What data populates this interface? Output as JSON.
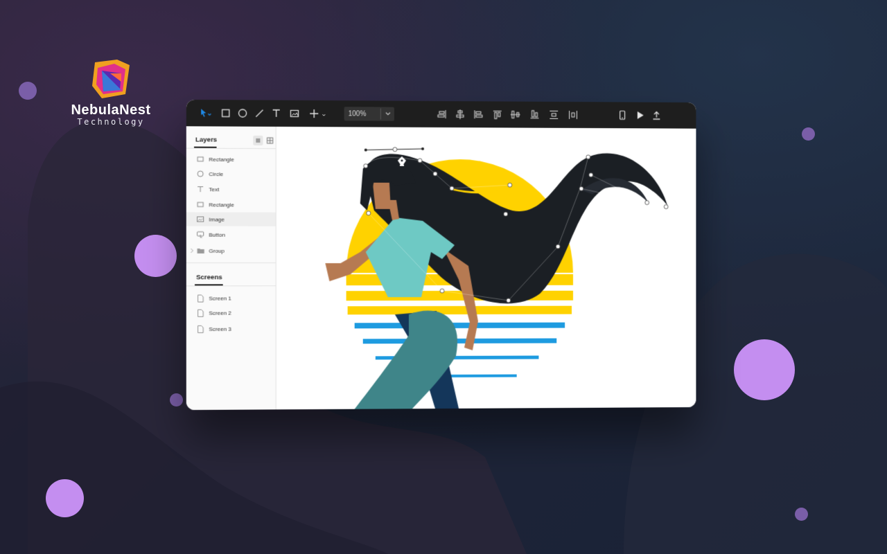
{
  "brand": {
    "name": "NebulaNest",
    "tagline": "Technology"
  },
  "toolbar": {
    "zoom": "100%",
    "tools": [
      "select-icon",
      "rectangle-icon",
      "ellipse-icon",
      "line-icon",
      "text-icon",
      "image-icon",
      "add-icon"
    ],
    "align_tools": [
      "align-right-icon",
      "align-center-horizontal-icon",
      "align-left-icon",
      "align-top-icon",
      "align-middle-vertical-icon",
      "align-bottom-icon",
      "distribute-vertical-icon",
      "distribute-horizontal-icon"
    ],
    "right_tools": [
      "device-preview-icon",
      "play-icon",
      "export-icon"
    ]
  },
  "layers_panel": {
    "title": "Layers",
    "items": [
      {
        "label": "Rectangle",
        "icon": "rectangle-icon"
      },
      {
        "label": "Circle",
        "icon": "circle-icon"
      },
      {
        "label": "Text",
        "icon": "text-icon"
      },
      {
        "label": "Rectangle",
        "icon": "rectangle-icon"
      },
      {
        "label": "Image",
        "icon": "image-icon"
      },
      {
        "label": "Button",
        "icon": "button-icon"
      },
      {
        "label": "Group",
        "icon": "folder-icon"
      }
    ],
    "selected_index": 4
  },
  "screens_panel": {
    "title": "Screens",
    "items": [
      "Screen 1",
      "Screen 2",
      "Screen 3"
    ]
  },
  "colors": {
    "accent": "#1e88e5",
    "toolbar_bg": "#1e1e1e",
    "sun_yellow": "#ffd200",
    "stripe_blue": "#1e9be0",
    "hair": "#1b1f24",
    "shirt": "#6ec9c4",
    "pants": "#3f8589",
    "skin": "#b67a52",
    "bubble": "#c48ef0"
  }
}
